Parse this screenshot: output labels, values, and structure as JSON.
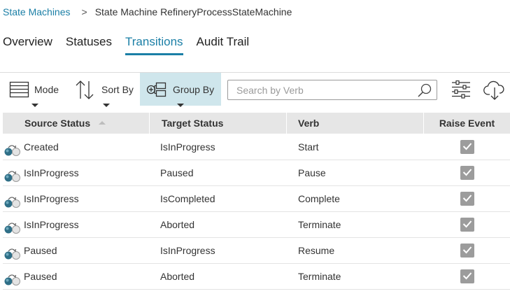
{
  "breadcrumb": {
    "root": "State Machines",
    "separator": ">",
    "current": "State Machine RefineryProcessStateMachine"
  },
  "tabs": [
    {
      "label": "Overview",
      "active": false
    },
    {
      "label": "Statuses",
      "active": false
    },
    {
      "label": "Transitions",
      "active": true
    },
    {
      "label": "Audit Trail",
      "active": false
    }
  ],
  "toolbar": {
    "mode_label": "Mode",
    "sort_label": "Sort By",
    "group_label": "Group By",
    "search_placeholder": "Search by Verb",
    "icons": [
      "mode-list-icon",
      "sort-arrows-icon",
      "group-by-icon",
      "search-icon",
      "filter-sliders-icon",
      "cloud-download-icon"
    ]
  },
  "table": {
    "columns": [
      "Source Status",
      "Target Status",
      "Verb",
      "Raise Event"
    ],
    "sorted_column": "Source Status",
    "sort_direction": "ascending",
    "rows": [
      {
        "source": "Created",
        "target": "IsInProgress",
        "verb": "Start",
        "raise_event": true
      },
      {
        "source": "IsInProgress",
        "target": "Paused",
        "verb": "Pause",
        "raise_event": true
      },
      {
        "source": "IsInProgress",
        "target": "IsCompleted",
        "verb": "Complete",
        "raise_event": true
      },
      {
        "source": "IsInProgress",
        "target": "Aborted",
        "verb": "Terminate",
        "raise_event": true
      },
      {
        "source": "Paused",
        "target": "IsInProgress",
        "verb": "Resume",
        "raise_event": true
      },
      {
        "source": "Paused",
        "target": "Aborted",
        "verb": "Terminate",
        "raise_event": true
      }
    ]
  },
  "colors": {
    "accent": "#1b7fa6",
    "group_by_bg": "#cfe6ec",
    "header_bg": "#e6e6e6",
    "checkbox": "#9c9c9c"
  }
}
